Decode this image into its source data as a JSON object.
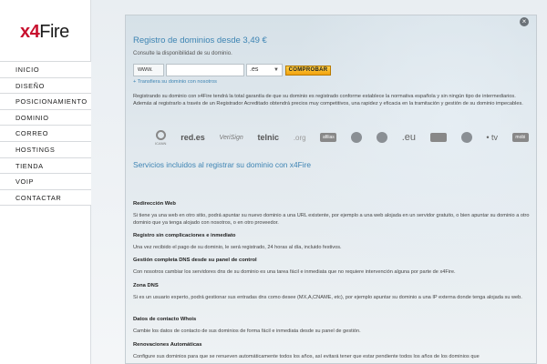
{
  "logo": {
    "x4": "x4",
    "fire": "Fire"
  },
  "nav": [
    "INICIO",
    "DISEÑO",
    "POSICIONAMIENTO",
    "DOMINIO",
    "CORREO",
    "HOSTINGS",
    "TIENDA",
    "VOIP",
    "CONTACTAR"
  ],
  "modal": {
    "close_glyph": "×",
    "title": "Registro de dominios desde 3,49 €",
    "subtitle": "Consulte la disponibilidad de su dominio.",
    "www_prefix": "www.",
    "domain_value": "",
    "tld_selected": ".es",
    "check_label": "COMPROBAR",
    "transfer_link": "+ Transfiera su dominio con nosotros",
    "paragraph": "Registrando su dominio con x4Fire tendrá la total garantía de que su dominio es registrado conforme establece la normativa española y sin ningún tipo de intermediarios. Además al registrarlo a través de un Registrador Acreditado obtendrá precios muy competitivos, una rapidez y eficacia en la tramitación y gestión de su dominio impecables.",
    "logos": [
      "ICANN",
      "red.es",
      "VeriSign",
      "telnic",
      ".org",
      "afilias",
      "",
      "",
      ".eu",
      "",
      "",
      "• tv",
      "mobi"
    ],
    "services_title": "Servicios incluidos al registrar su dominio con x4Fire",
    "sections": [
      {
        "heading": "Redirección Web",
        "text": "Si tiene ya una web en otro sitio, podrá apuntar su nuevo dominio a una URL existente, por ejemplo a una web alojada en un servidor gratuito, o bien apuntar su dominio a otro dominio que ya tenga alojado con nosotros, o en otro proveedor."
      },
      {
        "heading": "Registro sin complicaciones e inmediato",
        "text": "Una vez recibido el pago de su dominio, le será registrado, 24 horas al día, incluido festivos."
      },
      {
        "heading": "Gestión completa DNS desde su panel de control",
        "text": "Con nosotros cambiar los servidores dns de su dominio es una tarea fácil e inmediata que no requiere intervención alguna por parte de x4Fire."
      },
      {
        "heading": "Zona DNS",
        "text": "Si es un usuario experto, podrá gestionar sus entradas dns como desee (MX,A,CNAME, etc), por ejemplo apuntar su dominio a una IP externa donde tenga alojada su web."
      },
      {
        "heading": "Datos de contacto Whois",
        "text": "Cambie los datos de contacto de sus dominios de forma fácil e inmediata desde su panel de gestión."
      },
      {
        "heading": "Renovaciones Automáticas",
        "text": "Configure sus dominios para que se renueven automáticamente todos los años, así evitará tener que estar pendiente todos los años de los dominios que"
      }
    ]
  }
}
